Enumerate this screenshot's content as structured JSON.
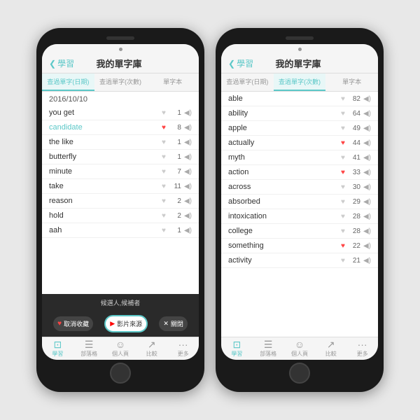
{
  "app": {
    "title": "我的單字庫",
    "back_label": "學習"
  },
  "phone1": {
    "tabs": [
      {
        "label": "查過單字(日期)",
        "active": true
      },
      {
        "label": "查過單字(次數)",
        "active": false
      },
      {
        "label": "單字本",
        "active": false
      }
    ],
    "date_header": "2016/10/10",
    "words": [
      {
        "text": "you get",
        "highlight": false,
        "heart_filled": false,
        "count": "1"
      },
      {
        "text": "candidate",
        "highlight": true,
        "heart_filled": true,
        "count": "8"
      },
      {
        "text": "the like",
        "highlight": false,
        "heart_filled": false,
        "count": "1"
      },
      {
        "text": "butterfly",
        "highlight": false,
        "heart_filled": false,
        "count": "1"
      },
      {
        "text": "minute",
        "highlight": false,
        "heart_filled": false,
        "count": "7"
      },
      {
        "text": "take",
        "highlight": false,
        "heart_filled": false,
        "count": "11"
      },
      {
        "text": "reason",
        "highlight": false,
        "heart_filled": false,
        "count": "2"
      },
      {
        "text": "hold",
        "highlight": false,
        "heart_filled": false,
        "count": "2"
      },
      {
        "text": "aah",
        "highlight": false,
        "heart_filled": false,
        "count": "1"
      }
    ],
    "popup_label": "候選人,候補者",
    "action_bar": {
      "cancel_label": "取消收藏",
      "youtube_label": "影片來源",
      "close_label": "關閉"
    },
    "bottom_nav": [
      {
        "label": "學習",
        "active": true,
        "icon": "⊞"
      },
      {
        "label": "部落格",
        "active": false,
        "icon": "☰"
      },
      {
        "label": "個人頁",
        "active": false,
        "icon": "👤"
      },
      {
        "label": "比較",
        "active": false,
        "icon": "↗"
      },
      {
        "label": "更多",
        "active": false,
        "icon": "···"
      }
    ]
  },
  "phone2": {
    "tabs": [
      {
        "label": "查過單字(日期)",
        "active": false
      },
      {
        "label": "查過單字(次數)",
        "active": true
      },
      {
        "label": "單字本",
        "active": false
      }
    ],
    "words": [
      {
        "text": "able",
        "highlight": false,
        "heart_filled": false,
        "count": "82"
      },
      {
        "text": "ability",
        "highlight": false,
        "heart_filled": false,
        "count": "64"
      },
      {
        "text": "apple",
        "highlight": false,
        "heart_filled": false,
        "count": "49"
      },
      {
        "text": "actually",
        "highlight": false,
        "heart_filled": true,
        "count": "44"
      },
      {
        "text": "myth",
        "highlight": false,
        "heart_filled": false,
        "count": "41"
      },
      {
        "text": "action",
        "highlight": false,
        "heart_filled": true,
        "count": "33"
      },
      {
        "text": "across",
        "highlight": false,
        "heart_filled": false,
        "count": "30"
      },
      {
        "text": "absorbed",
        "highlight": false,
        "heart_filled": false,
        "count": "29"
      },
      {
        "text": "intoxication",
        "highlight": false,
        "heart_filled": false,
        "count": "28"
      },
      {
        "text": "college",
        "highlight": false,
        "heart_filled": false,
        "count": "28"
      },
      {
        "text": "something",
        "highlight": false,
        "heart_filled": true,
        "count": "22"
      },
      {
        "text": "activity",
        "highlight": false,
        "heart_filled": false,
        "count": "21"
      }
    ],
    "bottom_nav": [
      {
        "label": "學習",
        "active": true,
        "icon": "⊞"
      },
      {
        "label": "部落格",
        "active": false,
        "icon": "☰"
      },
      {
        "label": "個人頁",
        "active": false,
        "icon": "👤"
      },
      {
        "label": "比較",
        "active": false,
        "icon": "↗"
      },
      {
        "label": "更多",
        "active": false,
        "icon": "···"
      }
    ]
  }
}
